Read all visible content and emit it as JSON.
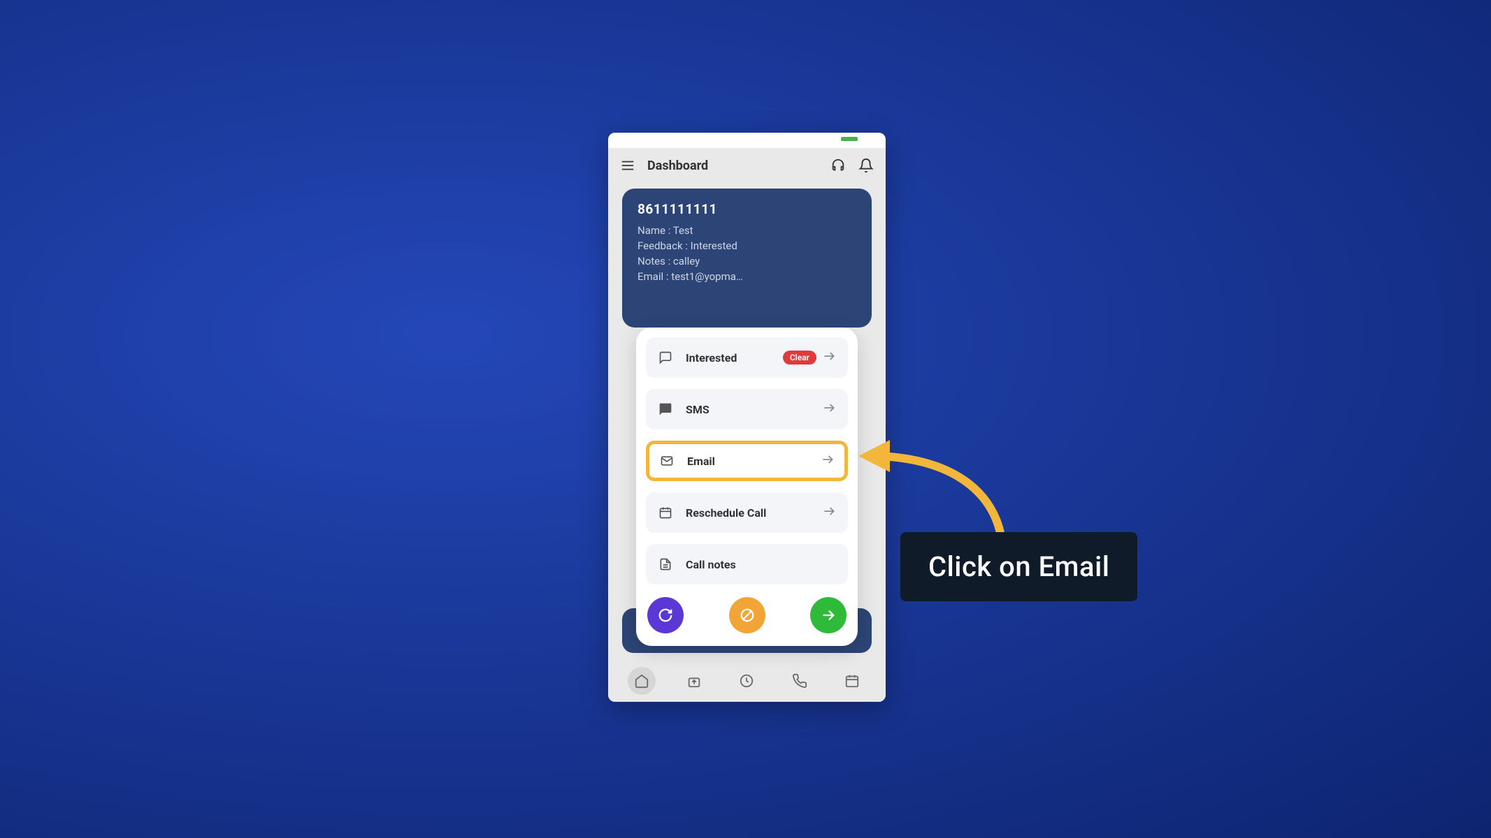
{
  "appbar": {
    "title": "Dashboard"
  },
  "contact": {
    "phone": "8611111111",
    "name_label": "Name : Test",
    "feedback_label": "Feedback : Interested",
    "notes_label": "Notes : calley",
    "email_label": "Email : test1@yopma…"
  },
  "sheet": {
    "options": {
      "interested": {
        "label": "Interested",
        "badge": "Clear"
      },
      "sms": {
        "label": "SMS"
      },
      "email": {
        "label": "Email"
      },
      "reschedule": {
        "label": "Reschedule Call"
      },
      "callnotes": {
        "label": "Call notes"
      }
    }
  },
  "callout": {
    "text": "Click on Email"
  }
}
